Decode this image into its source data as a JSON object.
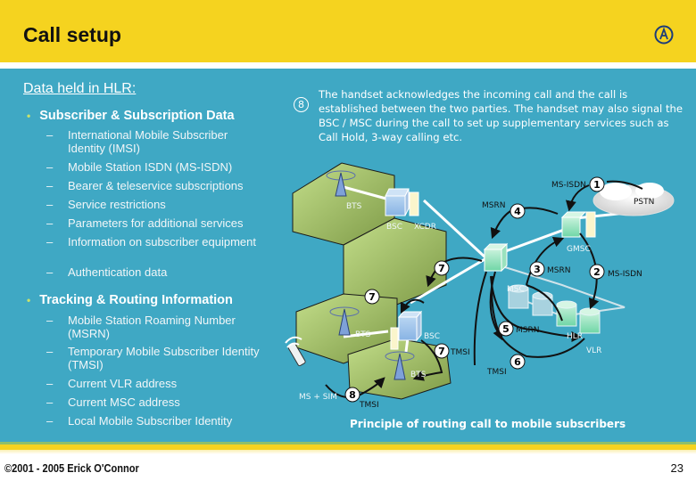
{
  "header": {
    "title": "Call setup",
    "logo_icon": "circle-a-logo-icon"
  },
  "left": {
    "heading": "Data held in HLR:",
    "sections": [
      {
        "title": "Subscriber & Subscription Data",
        "items": [
          "International Mobile Subscriber Identity (IMSI)",
          "Mobile Station ISDN (MS-ISDN)",
          "Bearer & teleservice subscriptions",
          "Service restrictions",
          "Parameters for additional services",
          "Information on subscriber equipment",
          "Authentication data"
        ]
      },
      {
        "title": "Tracking & Routing Information",
        "items": [
          "Mobile Station Roaming Number (MSRN)",
          "Temporary Mobile Subscriber Identity (TMSI)",
          "Current VLR address",
          "Current MSC address",
          "Local Mobile Subscriber Identity"
        ]
      }
    ],
    "bullet_glyph": "•",
    "dash_glyph": "–"
  },
  "right": {
    "step_number": "8",
    "description": "The handset acknowledges the incoming call and the call is established between the two parties. The handset may also signal the BSC / MSC during the call to set up supplementary services such as Call Hold, 3-way calling etc."
  },
  "diagram": {
    "caption": "Principle of routing call to mobile subscribers",
    "nodes": {
      "pstn": "PSTN",
      "gmsc": "GMSC",
      "msc": "MSC",
      "hlr": "HLR",
      "vlr": "VLR",
      "bsc_top": "BSC",
      "xcdr": "XCDR",
      "bsc_bottom": "BSC",
      "bts_1": "BTS",
      "bts_2": "BTS",
      "bts_3": "BTS",
      "ms": "MS + SIM"
    },
    "steps": [
      {
        "num": "1",
        "label": "MS-ISDN"
      },
      {
        "num": "2",
        "label": "MS-ISDN"
      },
      {
        "num": "3",
        "label": "MSRN"
      },
      {
        "num": "4",
        "label": "MSRN"
      },
      {
        "num": "5",
        "label": "MSRN"
      },
      {
        "num": "6",
        "label": "TMSI"
      },
      {
        "num": "7",
        "label": ""
      },
      {
        "num": "7",
        "label": ""
      },
      {
        "num": "7",
        "label": "TMSI"
      },
      {
        "num": "8",
        "label": "TMSI"
      }
    ],
    "colors": {
      "cell": "#a9c96a",
      "node_green": "#8fe0b8",
      "node_blue": "#9cc3ec",
      "node_cream": "#fbf5cc",
      "link": "#ffffff"
    }
  },
  "footer": {
    "copyright": "©2001 - 2005 Erick O'Connor",
    "page_number": "23"
  }
}
